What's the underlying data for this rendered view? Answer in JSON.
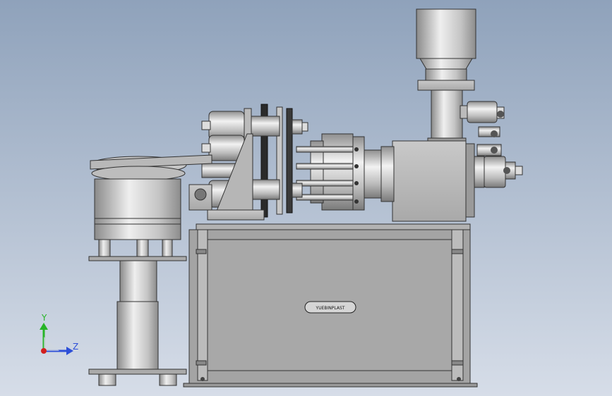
{
  "viewport": {
    "background_top": "#8fa2bb",
    "background_bottom": "#d6dde8",
    "metal_light": "#e6e6e6",
    "metal_mid": "#bdbdbd",
    "metal_dark": "#8a8a8a",
    "edge": "#2f2f2f"
  },
  "triad": {
    "y_label": "Y",
    "z_label": "Z",
    "y_color": "#27b427",
    "z_color": "#2d4fd8",
    "origin_color": "#d21f1f"
  },
  "nameplate": {
    "text": "YUEBINPLAST"
  }
}
